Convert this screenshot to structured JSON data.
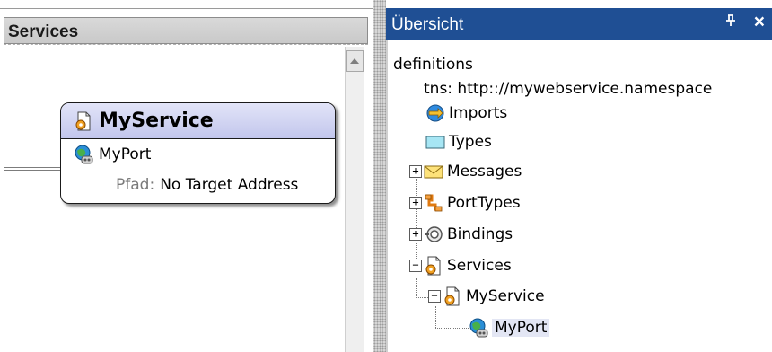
{
  "left_panel": {
    "title": "Services",
    "service_box": {
      "name": "MyService",
      "port": "MyPort",
      "path_label": "Pfad:",
      "path_value": "No Target Address"
    }
  },
  "right_panel": {
    "title": "Übersicht",
    "pin_glyph": "ᵽ",
    "close_glyph": "×",
    "tree": {
      "root": "definitions",
      "tns": "tns:  http:://mywebservice.namespace",
      "imports": "Imports",
      "types": "Types",
      "messages": "Messages",
      "porttypes": "PortTypes",
      "bindings": "Bindings",
      "services": "Services",
      "myservice": "MyService",
      "myport": "MyPort"
    }
  },
  "colors": {
    "header_active": "#1f4f94",
    "service_title_bg": "#c2c6ec",
    "selection_bg": "#e3e6f4"
  }
}
